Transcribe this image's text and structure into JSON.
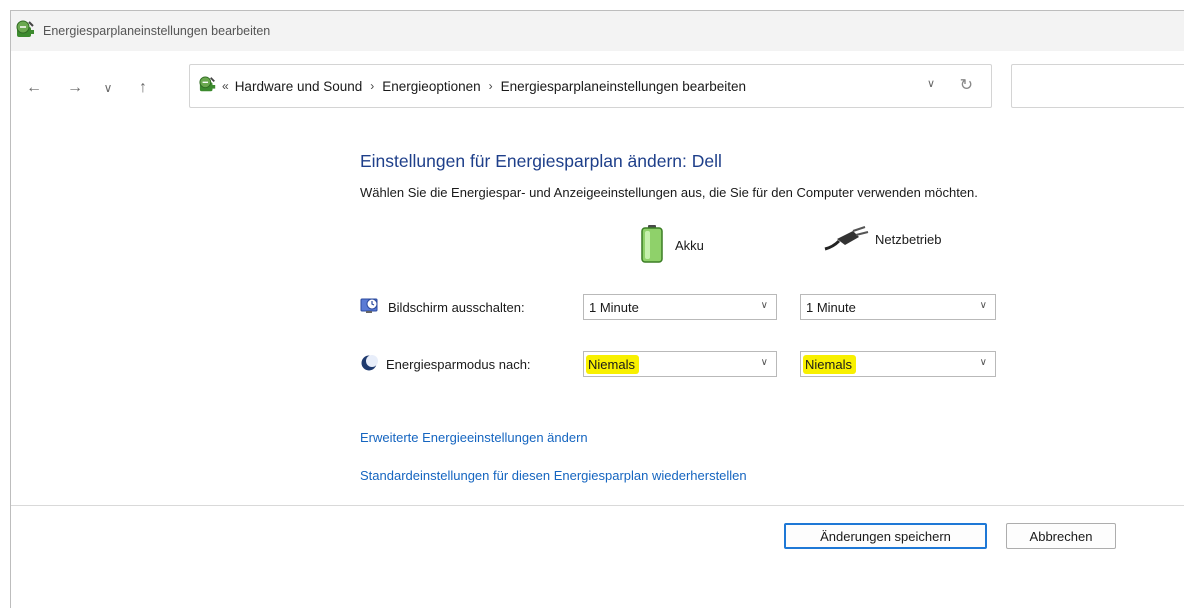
{
  "window": {
    "title": "Energiesparplaneinstellungen bearbeiten"
  },
  "nav": {
    "breadcrumb": [
      "Hardware und Sound",
      "Energieoptionen",
      "Energiesparplaneinstellungen bearbeiten"
    ],
    "overflow_marker": "«"
  },
  "main": {
    "heading": "Einstellungen für Energiesparplan ändern: Dell",
    "description": "Wählen Sie die Energiespar- und Anzeigeeinstellungen aus, die Sie für den Computer verwenden möchten.",
    "columns": {
      "battery": "Akku",
      "plugged_in": "Netzbetrieb"
    },
    "settings": [
      {
        "label": "Bildschirm ausschalten:",
        "icon": "display-clock-icon",
        "battery_value": "1 Minute",
        "plugged_value": "1 Minute",
        "highlighted": false
      },
      {
        "label": "Energiesparmodus nach:",
        "icon": "moon-sleep-icon",
        "battery_value": "Niemals",
        "plugged_value": "Niemals",
        "highlighted": true
      }
    ],
    "links": {
      "advanced": "Erweiterte Energieeinstellungen ändern",
      "restore": "Standardeinstellungen für diesen Energiesparplan wiederherstellen"
    }
  },
  "footer": {
    "save_label": "Änderungen speichern",
    "cancel_label": "Abbrechen"
  },
  "colors": {
    "heading": "#1e3f8a",
    "link": "#1565c0",
    "highlight": "#f8f000",
    "primary_border": "#1e78d6"
  }
}
